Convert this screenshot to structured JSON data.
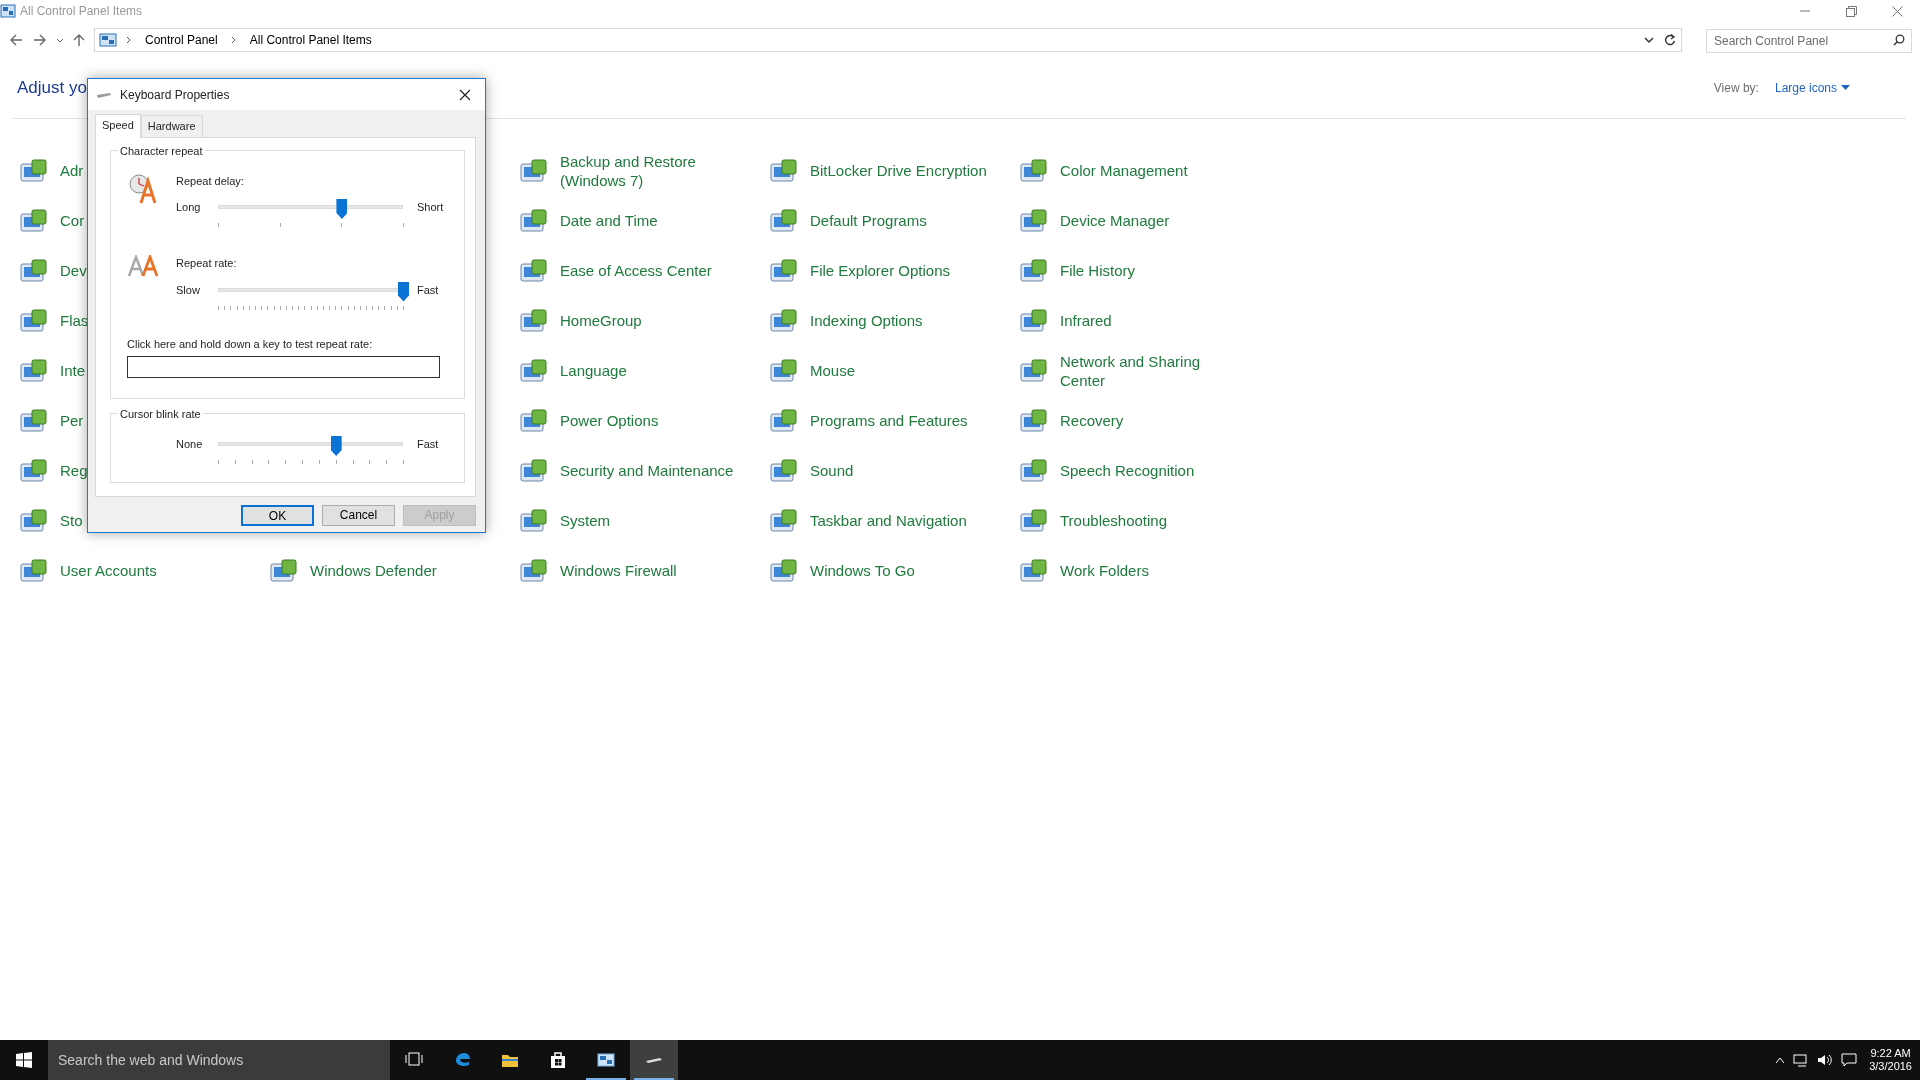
{
  "window": {
    "title": "All Control Panel Items"
  },
  "address_bar": {
    "path": [
      "Control Panel",
      "All Control Panel Items"
    ]
  },
  "search": {
    "placeholder": "Search Control Panel"
  },
  "heading": "Adjust yo",
  "view_by": {
    "label": "View by:",
    "value": "Large icons"
  },
  "rows": [
    {
      "cells": [
        {
          "label": "Adr"
        },
        null,
        {
          "label": "Backup and Restore (Windows 7)"
        },
        {
          "label": "BitLocker Drive Encryption"
        },
        {
          "label": "Color Management"
        }
      ]
    },
    {
      "cells": [
        {
          "label": "Cor"
        },
        null,
        {
          "label": "Date and Time"
        },
        {
          "label": "Default Programs"
        },
        {
          "label": "Device Manager"
        }
      ]
    },
    {
      "cells": [
        {
          "label": "Dev"
        },
        null,
        {
          "label": "Ease of Access Center"
        },
        {
          "label": "File Explorer Options"
        },
        {
          "label": "File History"
        }
      ]
    },
    {
      "cells": [
        {
          "label": "Flas"
        },
        null,
        {
          "label": "HomeGroup"
        },
        {
          "label": "Indexing Options"
        },
        {
          "label": "Infrared"
        }
      ]
    },
    {
      "cells": [
        {
          "label": "Inte"
        },
        null,
        {
          "label": "Language"
        },
        {
          "label": "Mouse"
        },
        {
          "label": "Network and Sharing Center"
        }
      ]
    },
    {
      "cells": [
        {
          "label": "Per"
        },
        null,
        {
          "label": "Power Options"
        },
        {
          "label": "Programs and Features"
        },
        {
          "label": "Recovery"
        }
      ]
    },
    {
      "cells": [
        {
          "label": "Reg"
        },
        null,
        {
          "label": "Security and Maintenance"
        },
        {
          "label": "Sound"
        },
        {
          "label": "Speech Recognition"
        }
      ]
    },
    {
      "cells": [
        {
          "label": "Sto"
        },
        null,
        {
          "label": "System"
        },
        {
          "label": "Taskbar and Navigation"
        },
        {
          "label": "Troubleshooting"
        }
      ]
    },
    {
      "cells": [
        {
          "label": "User Accounts"
        },
        {
          "label": "Windows Defender"
        },
        {
          "label": "Windows Firewall"
        },
        {
          "label": "Windows To Go"
        },
        {
          "label": "Work Folders"
        }
      ]
    }
  ],
  "dialog": {
    "title": "Keyboard Properties",
    "tabs": [
      {
        "label": "Speed",
        "selected": true
      },
      {
        "label": "Hardware",
        "selected": false
      }
    ],
    "groups": [
      {
        "title": "Character repeat",
        "sliders": [
          {
            "label": "Repeat delay:",
            "min_label": "Long",
            "max_label": "Short",
            "level": 0.667
          },
          {
            "label": "Repeat rate:",
            "min_label": "Slow",
            "max_label": "Fast",
            "level": 1
          }
        ],
        "test_field": {
          "label": "Click here and hold down a key to test repeat rate:"
        }
      },
      {
        "title": "Cursor blink rate",
        "sliders": [
          {
            "min_label": "None",
            "max_label": "Fast",
            "level": 0.636
          }
        ]
      }
    ],
    "buttons": [
      {
        "label": "OK",
        "default": true,
        "disabled": false
      },
      {
        "label": "Cancel",
        "default": false,
        "disabled": false
      },
      {
        "label": "Apply",
        "default": false,
        "disabled": true
      }
    ]
  },
  "taskbar": {
    "search": {
      "placeholder": "Search the web and Windows"
    },
    "apps": [
      {
        "kind": "task-view",
        "running": false,
        "selected": false
      },
      {
        "kind": "edge",
        "running": false,
        "selected": false
      },
      {
        "kind": "explorer",
        "running": false,
        "selected": false
      },
      {
        "kind": "store",
        "running": false,
        "selected": false
      },
      {
        "kind": "control-panel",
        "running": true,
        "selected": false
      },
      {
        "kind": "keyboard",
        "running": true,
        "selected": true
      }
    ],
    "clock": {
      "time": "9:22 AM",
      "date": "3/3/2016"
    }
  }
}
